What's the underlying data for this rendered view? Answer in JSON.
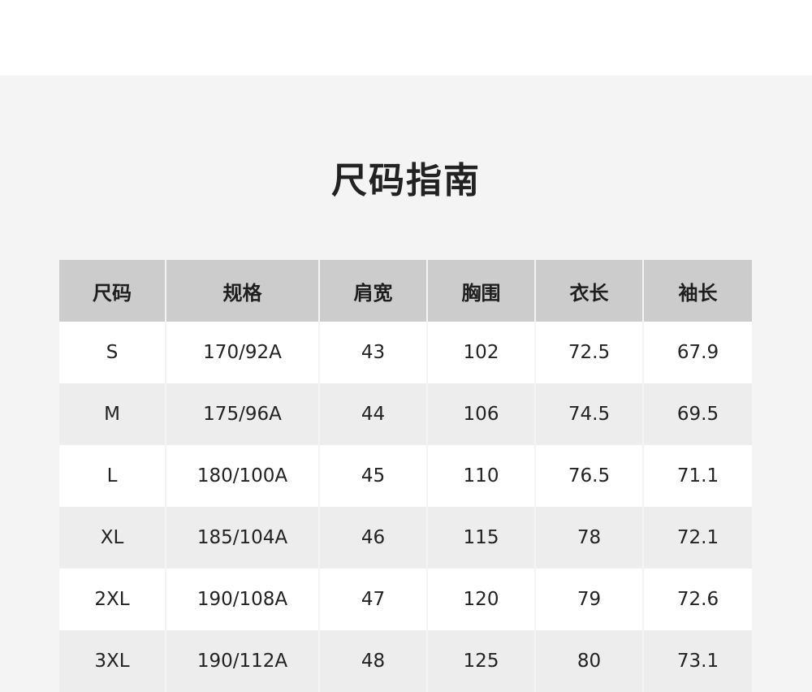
{
  "title": "尺码指南",
  "table": {
    "headers": [
      "尺码",
      "规格",
      "肩宽",
      "胸围",
      "衣长",
      "袖长"
    ],
    "rows": [
      [
        "S",
        "170/92A",
        "43",
        "102",
        "72.5",
        "67.9"
      ],
      [
        "M",
        "175/96A",
        "44",
        "106",
        "74.5",
        "69.5"
      ],
      [
        "L",
        "180/100A",
        "45",
        "110",
        "76.5",
        "71.1"
      ],
      [
        "XL",
        "185/104A",
        "46",
        "115",
        "78",
        "72.1"
      ],
      [
        "2XL",
        "190/108A",
        "47",
        "120",
        "79",
        "72.6"
      ],
      [
        "3XL",
        "190/112A",
        "48",
        "125",
        "80",
        "73.1"
      ]
    ]
  },
  "colors": {
    "header_bg": "#cccccc",
    "row_light": "#ffffff",
    "row_shaded": "#ededed",
    "page_bg": "#f4f4f4",
    "text": "#222222"
  }
}
